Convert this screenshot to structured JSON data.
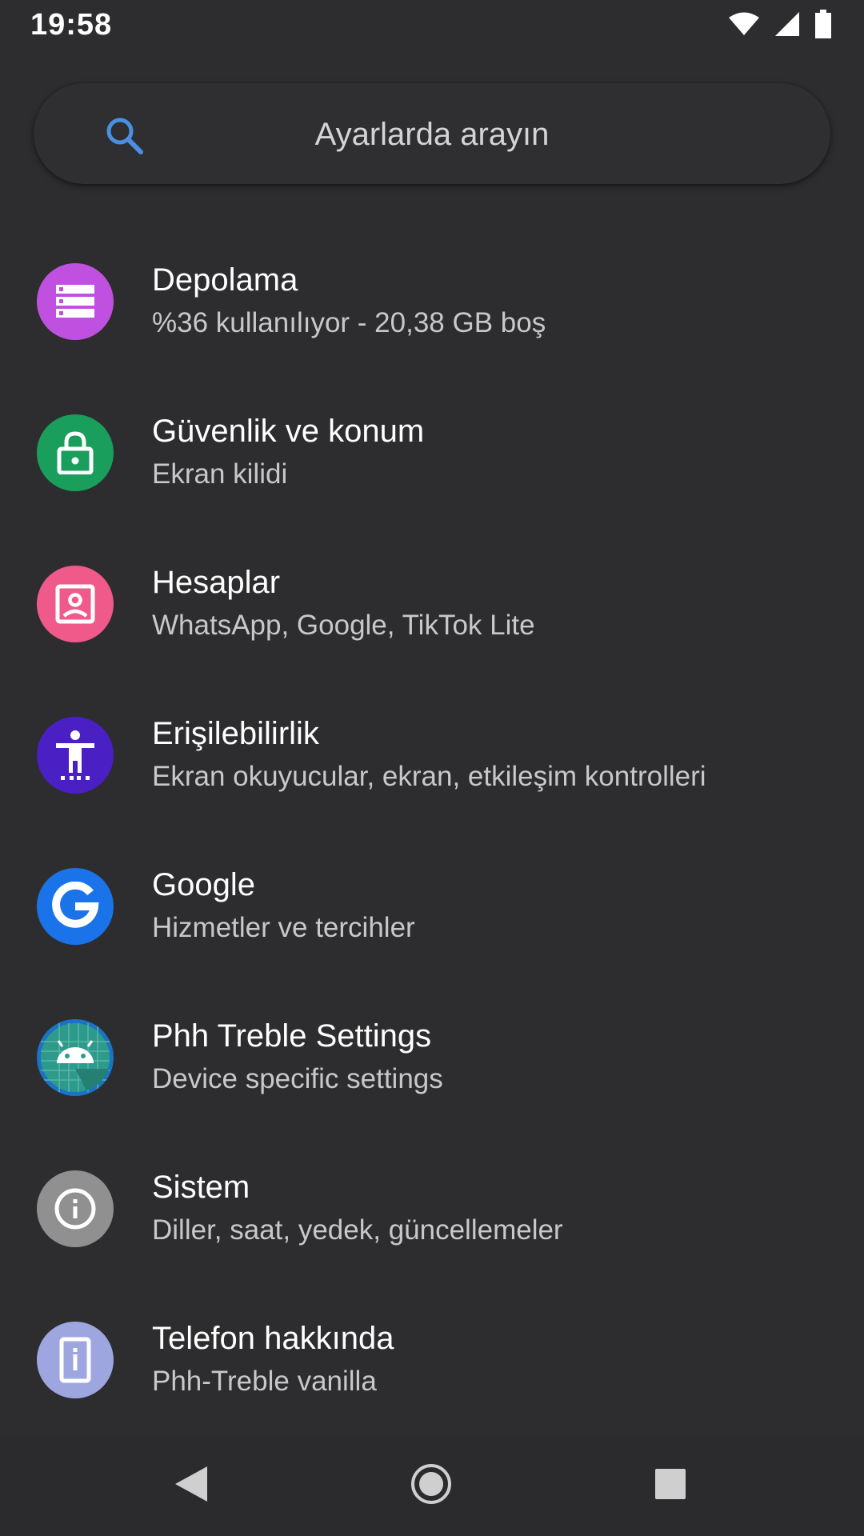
{
  "status_bar": {
    "time": "19:58",
    "icons": [
      "wifi-icon",
      "cellular-signal-icon",
      "battery-icon"
    ]
  },
  "search": {
    "placeholder": "Ayarlarda arayın",
    "icon": "search-icon",
    "icon_color": "#4a90e2"
  },
  "settings": [
    {
      "key": "storage",
      "title": "Depolama",
      "subtitle": "%36 kullanılıyor - 20,38 GB boş",
      "icon": "storage-icon",
      "color": "#c051e0"
    },
    {
      "key": "security",
      "title": "Güvenlik ve konum",
      "subtitle": "Ekran kilidi",
      "icon": "lock-icon",
      "color": "#1a9e5c"
    },
    {
      "key": "accounts",
      "title": "Hesaplar",
      "subtitle": "WhatsApp, Google, TikTok Lite",
      "icon": "account-box-icon",
      "color": "#ef5a8a"
    },
    {
      "key": "accessibility",
      "title": "Erişilebilirlik",
      "subtitle": "Ekran okuyucular, ekran, etkileşim kontrolleri",
      "icon": "accessibility-icon",
      "color": "#4a1fc4"
    },
    {
      "key": "google",
      "title": "Google",
      "subtitle": "Hizmetler ve tercihler",
      "icon": "google-g-icon",
      "color": "#1a73e8"
    },
    {
      "key": "phh",
      "title": "Phh Treble Settings",
      "subtitle": "Device specific settings",
      "icon": "android-robot-icon",
      "color": "#2e9a8c"
    },
    {
      "key": "system",
      "title": "Sistem",
      "subtitle": "Diller, saat, yedek, güncellemeler",
      "icon": "info-icon",
      "color": "#909090"
    },
    {
      "key": "about",
      "title": "Telefon hakkında",
      "subtitle": "Phh-Treble vanilla",
      "icon": "phone-info-icon",
      "color": "#9ea6e0"
    }
  ],
  "nav_bar": {
    "back": "back-triangle-icon",
    "home": "home-circle-icon",
    "recents": "recents-square-icon"
  }
}
